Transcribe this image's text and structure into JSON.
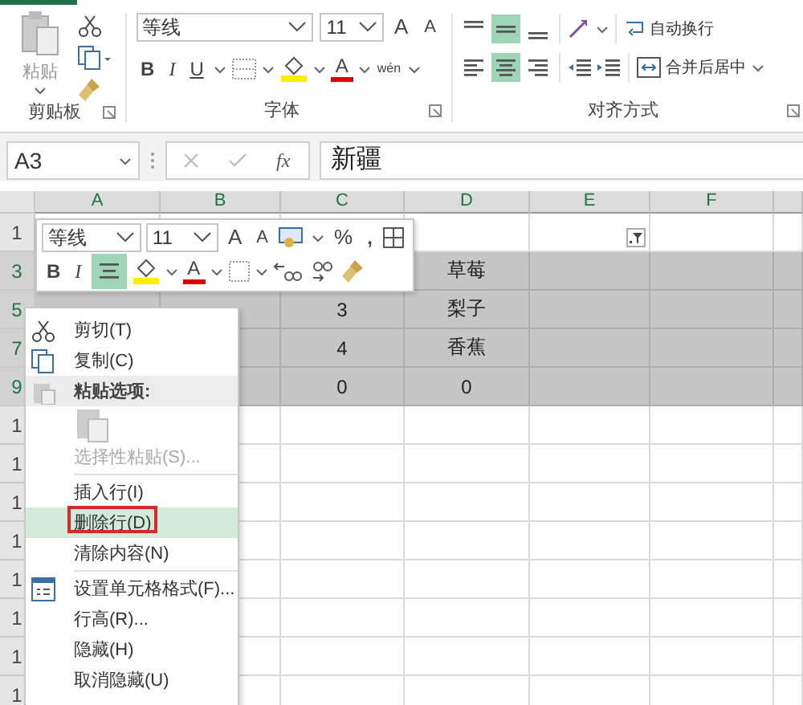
{
  "ribbon": {
    "clipboard": {
      "paste": "粘贴",
      "label": "剪贴板"
    },
    "font": {
      "font_name": "等线",
      "font_size": "11",
      "grow": "A",
      "shrink": "A",
      "bold": "B",
      "italic": "I",
      "underline": "U",
      "color_letter": "A",
      "phonetic": "wén",
      "label": "字体"
    },
    "alignment": {
      "vertical": [
        {
          "selected": false
        },
        {
          "selected": true
        },
        {
          "selected": false
        }
      ],
      "horizontal": [
        {
          "selected": false
        },
        {
          "selected": true
        },
        {
          "selected": false
        }
      ],
      "wrap": "自动换行",
      "merge": "合并后居中",
      "label": "对齐方式"
    }
  },
  "formula_bar": {
    "name_box": "A3",
    "fx": "fx",
    "value": "新疆"
  },
  "sheet": {
    "columns": [
      "A",
      "B",
      "C",
      "D",
      "E",
      "F",
      null
    ],
    "rows": [
      {
        "header": "1",
        "selected": false,
        "cells": [
          null,
          null,
          null,
          null,
          {
            "kind": "filter"
          },
          null,
          null
        ]
      },
      {
        "header": "3",
        "selected": true,
        "cells": [
          null,
          null,
          null,
          "草莓",
          null,
          null,
          null
        ]
      },
      {
        "header": "5",
        "selected": true,
        "cells": [
          null,
          null,
          "3",
          "梨子",
          null,
          null,
          null
        ]
      },
      {
        "header": "7",
        "selected": true,
        "cells": [
          null,
          null,
          "4",
          "香蕉",
          null,
          null,
          null
        ]
      },
      {
        "header": "9",
        "selected": true,
        "cells": [
          null,
          null,
          "0",
          "0",
          null,
          null,
          null
        ]
      },
      {
        "header": "1",
        "selected": false,
        "cells": [
          null,
          null,
          null,
          null,
          null,
          null,
          null
        ]
      },
      {
        "header": "1",
        "selected": false,
        "cells": [
          null,
          null,
          null,
          null,
          null,
          null,
          null
        ]
      },
      {
        "header": "1",
        "selected": false,
        "cells": [
          null,
          null,
          null,
          null,
          null,
          null,
          null
        ]
      },
      {
        "header": "1",
        "selected": false,
        "cells": [
          null,
          null,
          null,
          null,
          null,
          null,
          null
        ]
      },
      {
        "header": "1",
        "selected": false,
        "cells": [
          null,
          null,
          null,
          null,
          null,
          null,
          null
        ]
      },
      {
        "header": "1",
        "selected": false,
        "cells": [
          null,
          null,
          null,
          null,
          null,
          null,
          null
        ]
      },
      {
        "header": "1",
        "selected": false,
        "cells": [
          null,
          null,
          null,
          null,
          null,
          null,
          null
        ]
      },
      {
        "header": "1",
        "selected": false,
        "cells": [
          null,
          null,
          null,
          null,
          null,
          null,
          null
        ]
      }
    ]
  },
  "mini_toolbar": {
    "font_name": "等线",
    "font_size": "11",
    "grow": "A",
    "shrink": "A",
    "percent": "%",
    "comma": ",",
    "bold": "B",
    "italic": "I",
    "center_selected": true,
    "color_letter": "A"
  },
  "context_menu": [
    {
      "kind": "cut",
      "label": "剪切(T)",
      "selected": false,
      "disabled": false
    },
    {
      "kind": "copy",
      "label": "复制(C)",
      "selected": false,
      "disabled": false
    },
    {
      "kind": "heading",
      "label": "粘贴选项:",
      "selected": false,
      "disabled": false
    },
    {
      "kind": "paste",
      "selected": false,
      "disabled": false
    },
    {
      "kind": "plain",
      "label": "选择性粘贴(S)...",
      "selected": false,
      "disabled": true
    },
    {
      "kind": "separator"
    },
    {
      "kind": "plain",
      "label": "插入行(I)",
      "selected": false,
      "disabled": false
    },
    {
      "kind": "plain",
      "label": "删除行(D)",
      "selected": true,
      "disabled": false,
      "marked": true
    },
    {
      "kind": "plain",
      "label": "清除内容(N)",
      "selected": false,
      "disabled": false
    },
    {
      "kind": "separator"
    },
    {
      "kind": "format",
      "label": "设置单元格格式(F)...",
      "selected": false,
      "disabled": false
    },
    {
      "kind": "plain",
      "label": "行高(R)...",
      "selected": false,
      "disabled": false
    },
    {
      "kind": "plain",
      "label": "隐藏(H)",
      "selected": false,
      "disabled": false
    },
    {
      "kind": "plain",
      "label": "取消隐藏(U)",
      "selected": false,
      "disabled": false
    }
  ]
}
